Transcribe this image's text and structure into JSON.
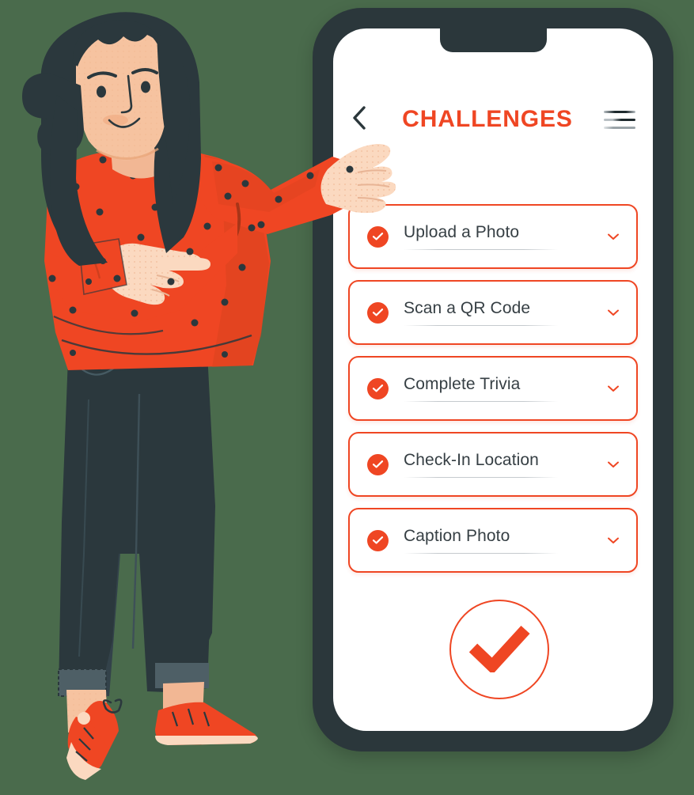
{
  "background": {
    "color": "#4a6b4c"
  },
  "device": {
    "frame_color": "#2b373b",
    "screen_color": "#ffffff",
    "name": "smartphone-mockup"
  },
  "theme": {
    "accent": "#ef4623",
    "text_dark": "#363f44",
    "underline": "#c5cace",
    "hair": "#2b383d",
    "sweater": "#ef4623",
    "sweater_shadow": "#c83d1f",
    "skin": "#f6c3a0",
    "skin_light": "#fbd9c0",
    "jeans": "#2b383d",
    "jeans_cuff": "#4e5f66",
    "shoe": "#ef4623",
    "shoe_sole": "#fbd9c0"
  },
  "header": {
    "title": "CHALLENGES",
    "back_icon": "chevron-left-icon",
    "menu_icon": "hamburger-menu-icon"
  },
  "challenges": [
    {
      "label": "Upload a Photo",
      "completed": true,
      "status_icon": "check-circle-icon",
      "expand_icon": "chevron-down-icon"
    },
    {
      "label": "Scan a QR Code",
      "completed": true,
      "status_icon": "check-circle-icon",
      "expand_icon": "chevron-down-icon"
    },
    {
      "label": "Complete Trivia",
      "completed": true,
      "status_icon": "check-circle-icon",
      "expand_icon": "chevron-down-icon"
    },
    {
      "label": "Check-In Location",
      "completed": true,
      "status_icon": "check-circle-icon",
      "expand_icon": "chevron-down-icon"
    },
    {
      "label": "Caption Photo",
      "completed": true,
      "status_icon": "check-circle-icon",
      "expand_icon": "chevron-down-icon"
    }
  ],
  "confirm": {
    "icon": "large-checkmark-icon",
    "label": ""
  },
  "illustration": {
    "name": "woman-pointing-at-phone",
    "description": "Flat-style illustration of a woman with long dark hair and a hair bun, wearing an orange polka-dot sweater and dark navy cuffed jeans with orange sneakers. Her right arm reaches toward the phone and her left hand points."
  }
}
